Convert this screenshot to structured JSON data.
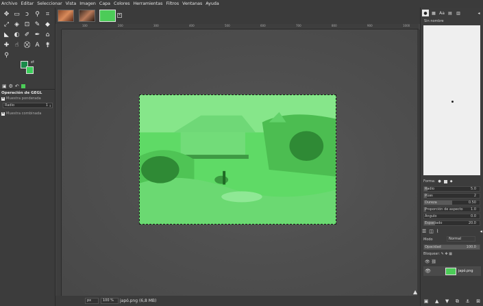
{
  "menu": [
    "Archivo",
    "Editar",
    "Seleccionar",
    "Vista",
    "Imagen",
    "Capa",
    "Colores",
    "Herramientas",
    "Filtros",
    "Ventanas",
    "Ayuda"
  ],
  "colors": {
    "foreground": "#1b8a4a",
    "background": "#3ccf5b",
    "image_tint": "#58d760"
  },
  "tool_options": {
    "title": "Operación de GEGL",
    "muestra_ponderada": "Muestra ponderada",
    "radio_label": "Radio",
    "radio_value": "1",
    "muestra_combinada": "Muestra combinada"
  },
  "image_tabs": [
    "image-tab-1",
    "image-tab-2",
    "image-tab-3"
  ],
  "ruler_ticks": [
    "100",
    "200",
    "300",
    "400",
    "500",
    "600",
    "700",
    "800",
    "900",
    "1000"
  ],
  "status": {
    "unit": "px",
    "zoom": "100 %",
    "info": "japó.png (6,8 MB)"
  },
  "brushes": {
    "name": "Sin nombre",
    "forma_label": "Forma:",
    "params": [
      {
        "label": "Radio",
        "value": "5.0",
        "fill": 0.06
      },
      {
        "label": "Púas",
        "value": "2",
        "fill": 0.05
      },
      {
        "label": "Dureza",
        "value": "0.50",
        "fill": 0.5
      },
      {
        "label": "Proporción de aspecto",
        "value": "1.0",
        "fill": 0.04
      },
      {
        "label": "Ángulo",
        "value": "0.0",
        "fill": 0.0
      },
      {
        "label": "Espaciado",
        "value": "20.0",
        "fill": 0.2
      }
    ]
  },
  "layers": {
    "modo_label": "Modo",
    "modo_value": "Normal",
    "opacidad_label": "Opacidad",
    "opacidad_value": "100.0",
    "bloquear_label": "Bloquear:",
    "layer_name": "japó.png"
  }
}
